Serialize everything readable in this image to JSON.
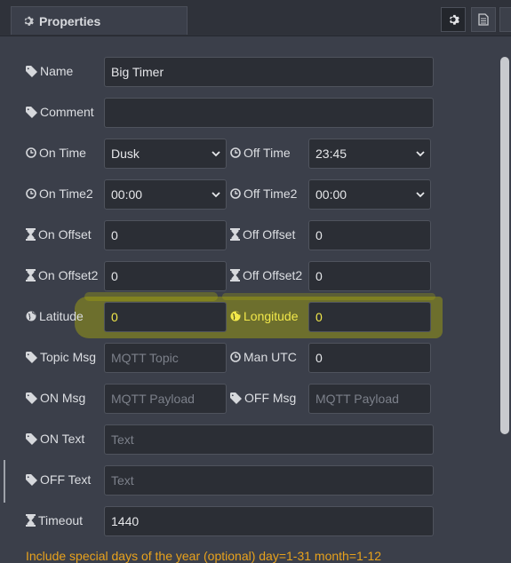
{
  "header": {
    "tab_label": "Properties",
    "buttons": [
      "gear-icon",
      "description-icon",
      "layout-icon"
    ]
  },
  "form": {
    "name": {
      "label": "Name",
      "value": "Big Timer"
    },
    "comment": {
      "label": "Comment",
      "value": ""
    },
    "on_time": {
      "label": "On Time",
      "value": "Dusk"
    },
    "off_time": {
      "label": "Off Time",
      "value": "23:45"
    },
    "on_time2": {
      "label": "On Time2",
      "value": "00:00"
    },
    "off_time2": {
      "label": "Off Time2",
      "value": "00:00"
    },
    "on_offset": {
      "label": "On Offset",
      "value": "0"
    },
    "off_offset": {
      "label": "Off Offset",
      "value": "0"
    },
    "on_offset2": {
      "label": "On Offset2",
      "value": "0"
    },
    "off_offset2": {
      "label": "Off Offset2",
      "value": "0"
    },
    "latitude": {
      "label": "Latitude",
      "value": "0"
    },
    "longitude": {
      "label": "Longitude",
      "value": "0"
    },
    "topic_msg": {
      "label": "Topic Msg",
      "placeholder": "MQTT Topic"
    },
    "man_utc": {
      "label": "Man UTC",
      "value": "0"
    },
    "on_msg": {
      "label": "ON Msg",
      "placeholder": "MQTT Payload"
    },
    "off_msg": {
      "label": "OFF Msg",
      "placeholder": "MQTT Payload"
    },
    "on_text": {
      "label": "ON Text",
      "placeholder": "Text"
    },
    "off_text": {
      "label": "OFF Text",
      "placeholder": "Text"
    },
    "timeout": {
      "label": "Timeout",
      "value": "1440"
    }
  },
  "note": "Include special days of the year (optional) day=1-31 month=1-12",
  "colors": {
    "highlight": "#aaaa0a",
    "note": "#e8a21c",
    "background": "#3b3f4a"
  }
}
